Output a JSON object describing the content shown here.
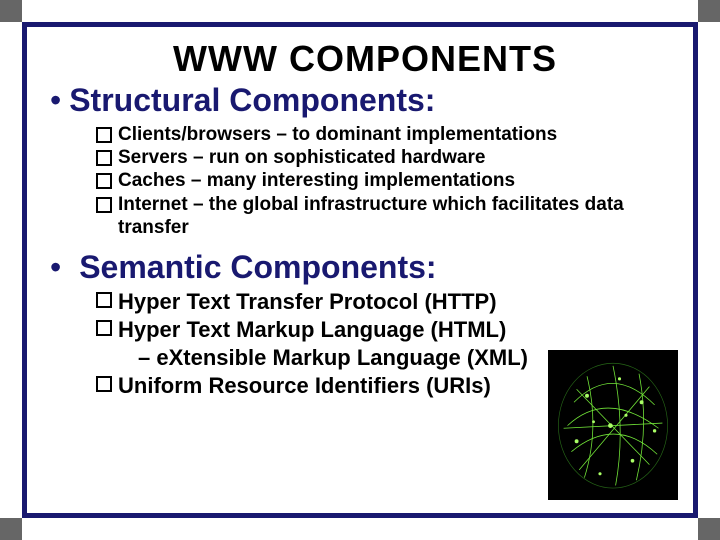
{
  "title": "WWW COMPONENTS",
  "sections": [
    {
      "heading": "Structural Components:",
      "items": [
        "Clients/browsers – to dominant implementations",
        "Servers – run on sophisticated hardware",
        "Caches – many interesting implementations",
        "Internet – the global infrastructure which facilitates data transfer"
      ]
    },
    {
      "heading": "Semantic Components:",
      "items": [
        "Hyper Text Transfer Protocol (HTTP)",
        "Hyper Text Markup Language (HTML)",
        "– eXtensible Markup Language (XML)",
        "Uniform Resource Identifiers (URIs)"
      ]
    }
  ]
}
